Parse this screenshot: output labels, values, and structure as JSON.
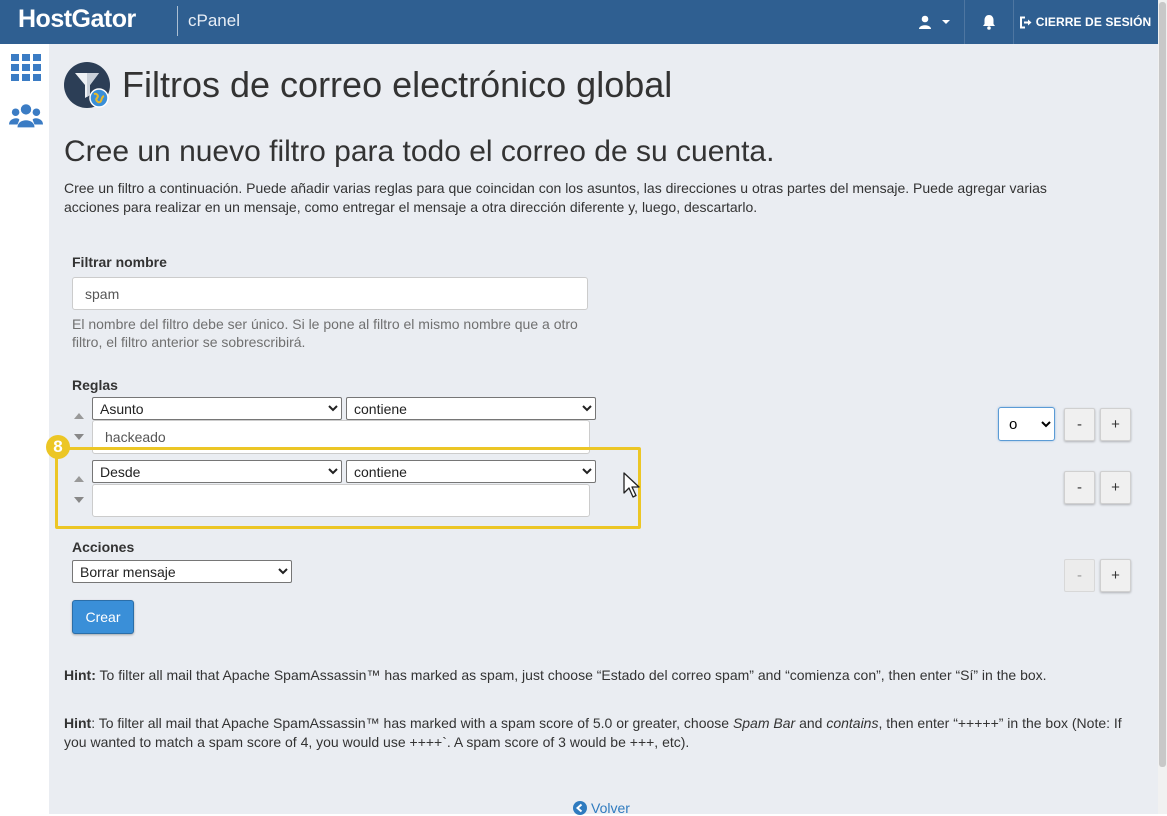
{
  "topbar": {
    "brand": "HostGator",
    "product": "cPanel",
    "logout_label": "CIERRE DE SESIÓN",
    "icons": [
      "user-icon",
      "bell-icon",
      "logout-icon"
    ]
  },
  "sidebar": {
    "items": [
      {
        "icon": "grid-icon"
      },
      {
        "icon": "users-icon"
      }
    ]
  },
  "page": {
    "title": "Filtros de correo electrónico global",
    "subtitle": "Cree un nuevo filtro para todo el correo de su cuenta.",
    "description": "Cree un filtro a continuación. Puede añadir varias reglas para que coincidan con los asuntos, las direcciones u otras partes del mensaje. Puede agregar varias acciones para realizar en un mensaje, como entregar el mensaje a otra dirección diferente y, luego, descartarlo."
  },
  "form": {
    "filter_name_label": "Filtrar nombre",
    "filter_name_value": "spam",
    "filter_name_help": "El nombre del filtro debe ser único. Si le pone al filtro el mismo nombre que a otro filtro, el filtro anterior se sobrescribirá.",
    "rules_label": "Reglas",
    "rules": [
      {
        "field": "Asunto",
        "condition": "contiene",
        "value": "hackeado",
        "operator": "o"
      },
      {
        "field": "Desde",
        "condition": "contiene",
        "value": ""
      }
    ],
    "minus_label": "-",
    "plus_label": "+",
    "actions_label": "Acciones",
    "action_value": "Borrar mensaje",
    "create_label": "Crear"
  },
  "annotation": {
    "step_number": "8",
    "color": "#ecc625"
  },
  "hints": {
    "hint1_prefix": "Hint:",
    "hint1_text": " To filter all mail that Apache SpamAssassin™ has marked as spam, just choose “Estado del correo spam” and “comienza con”, then enter “Sí” in the box.",
    "hint2_prefix": "Hint",
    "hint2_a": ": To filter all mail that Apache SpamAssassin™ has marked with a spam score of 5.0 or greater, choose ",
    "hint2_em1": "Spam Bar",
    "hint2_b": " and ",
    "hint2_em2": "contains",
    "hint2_c": ", then enter “+++++” in the box (Note: If you wanted to match a spam score of 4, you would use ++++`. A spam score of 3 would be +++, etc)."
  },
  "footer": {
    "back_label": "Volver"
  },
  "colors": {
    "topbar": "#2f5f91",
    "background": "#eaedf2",
    "primary": "#3a8fd8",
    "link": "#2f7bbf"
  }
}
